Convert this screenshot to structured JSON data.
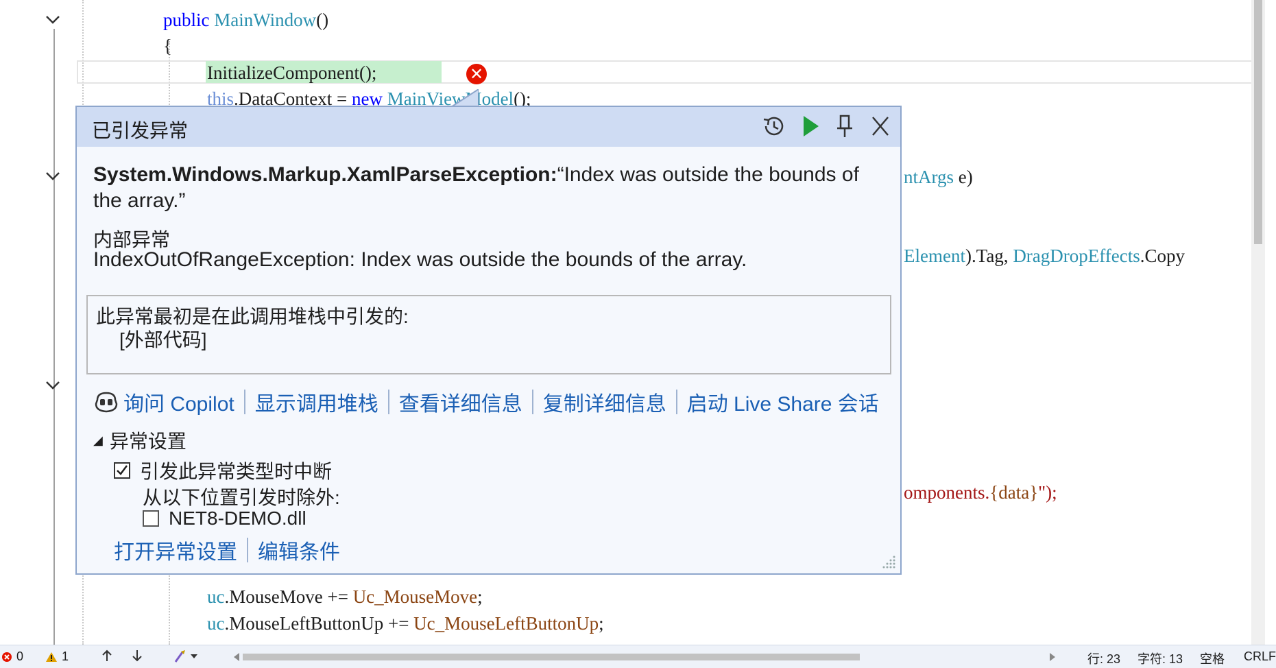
{
  "editor": {
    "lines": {
      "l1_kw": "public",
      "l1_name": "MainWindow",
      "l1_rest": "()",
      "l2": "{",
      "l3": "InitializeComponent();",
      "l4_this": "this",
      "l4_mid": ".DataContext = ",
      "l4_new": "new",
      "l4_type": "MainViewModel",
      "l4_rest": "();",
      "r1_type": "ntArgs",
      "r1_rest": " e)",
      "r2_type": "Element",
      "r2_mid": ").Tag, ",
      "r2_type2": "DragDropEffects",
      "r2_rest": ".Copy",
      "r3_str": "omponents.",
      "r3_brace": "{data}",
      "r3_rest": "\");",
      "b1_obj": "uc",
      "b1_mid": ".MouseMove += ",
      "b1_handler": "Uc_MouseMove",
      "b1_end": ";",
      "b2_obj": "uc",
      "b2_mid": ".MouseLeftButtonUp += ",
      "b2_handler": "Uc_MouseLeftButtonUp",
      "b2_end": ";"
    }
  },
  "popup": {
    "title": "已引发异常",
    "exception_type": "System.Windows.Markup.XamlParseException:",
    "exception_message": "“Index was outside the bounds of the array.”",
    "inner_label": "内部异常",
    "inner_message": "IndexOutOfRangeException: Index was outside the bounds of the array.",
    "stack_title": "此异常最初是在此调用堆栈中引发的:",
    "stack_frame": "[外部代码]",
    "links": {
      "copilot": "询问 Copilot",
      "show_stack": "显示调用堆栈",
      "view_details": "查看详细信息",
      "copy_details": "复制详细信息",
      "live_share": "启动 Live Share 会话"
    },
    "settings": {
      "header": "异常设置",
      "break_label": "引发此异常类型时中断",
      "break_checked": true,
      "except_label": "从以下位置引发时除外:",
      "module_label": "NET8-DEMO.dll",
      "module_checked": false,
      "open_settings": "打开异常设置",
      "edit_conditions": "编辑条件"
    }
  },
  "statusbar": {
    "errors": "0",
    "warnings": "1",
    "line": "行: 23",
    "char": "字符: 13",
    "spacing": "空格",
    "line_ending": "CRLF"
  },
  "colors": {
    "popup_header": "#cfdcf3",
    "link": "#1a5fb4",
    "error": "#e51400",
    "highlight": "#c6efce"
  }
}
